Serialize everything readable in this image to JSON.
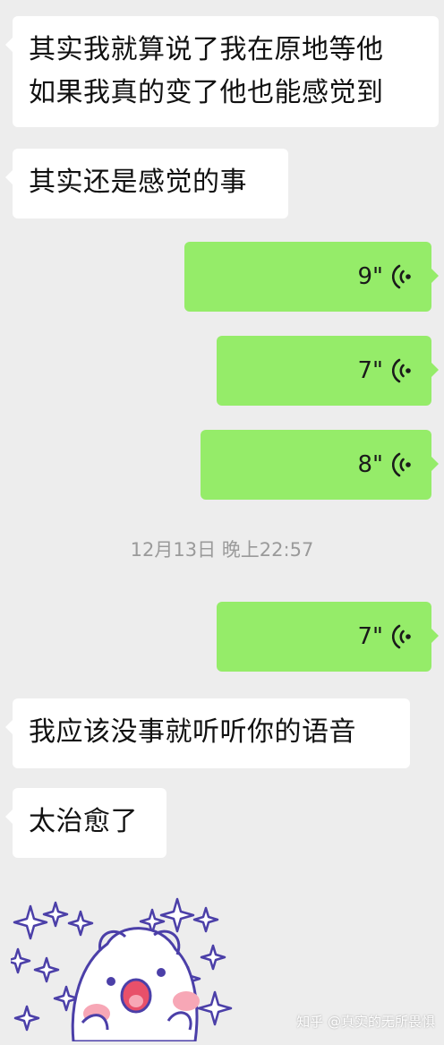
{
  "messages": {
    "m1_line1": "其实我就算说了我在原地等他",
    "m1_line2": "如果我真的变了他也能感觉到",
    "m2": "其实还是感觉的事",
    "v1": "9\"",
    "v2": "7\"",
    "v3": "8\"",
    "timestamp": "12月13日 晚上22:57",
    "v4": "7\"",
    "m3": "我应该没事就听听你的语音",
    "m4": "太治愈了"
  },
  "watermark": "知乎 @真实的无所畏惧",
  "colors": {
    "background": "#ededed",
    "incoming_bubble": "#ffffff",
    "outgoing_bubble": "#95ec69",
    "timestamp_text": "#9a9a9a"
  },
  "icons": {
    "voice": "voice-wave-icon",
    "sticker": "cartoon-sticker"
  }
}
